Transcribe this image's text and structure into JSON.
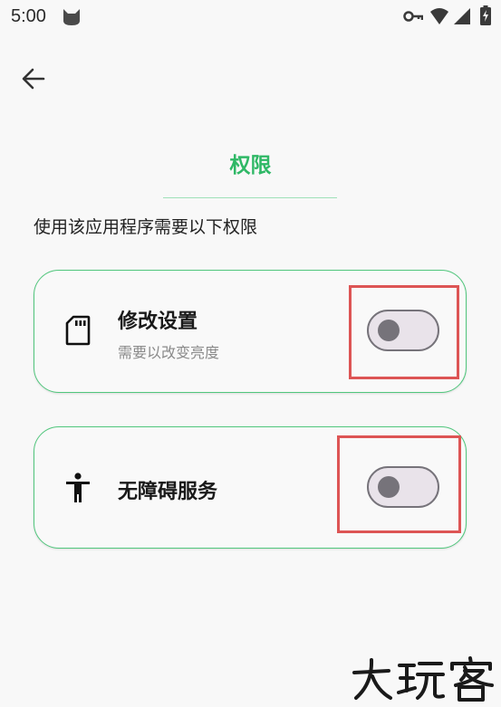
{
  "status_bar": {
    "time": "5:00",
    "icons": [
      "cat-icon",
      "key-icon",
      "wifi-icon",
      "signal-icon",
      "battery-charging-icon"
    ]
  },
  "header": {
    "back_icon": "arrow-left-icon",
    "title": "权限",
    "subtitle": "使用该应用程序需要以下权限"
  },
  "permissions": [
    {
      "icon": "sd-card-icon",
      "title": "修改设置",
      "description": "需要以改变亮度",
      "enabled": false
    },
    {
      "icon": "accessibility-icon",
      "title": "无障碍服务",
      "description": "",
      "enabled": false
    }
  ],
  "watermark": {
    "text": "大玩客"
  },
  "colors": {
    "accent": "#2fb866",
    "card_border": "#51c77d",
    "highlight": "#dd5555",
    "toggle_off": "#76737a"
  }
}
